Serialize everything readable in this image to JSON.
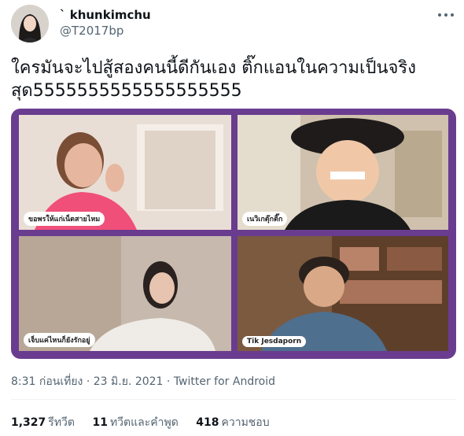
{
  "user": {
    "display_name": "` khunkimchu",
    "handle": "@T2017bp"
  },
  "tweet": {
    "line1": "ใครมันจะไปสู้สองคนนี้ดีกันเอง ติ๊กแอนในความเป็นจริง",
    "line2": "สุด5555555555555555555"
  },
  "video_call": {
    "participants": [
      {
        "name": "ขอพรให้แก่เน็ตสายไหม"
      },
      {
        "name": "เนวิเกตุ๊กติ๊ก"
      },
      {
        "name": "เจ็บแค่ไหนก็ยังรักอยู่"
      },
      {
        "name": "Tik Jesdaporn"
      }
    ]
  },
  "meta": {
    "time": "8:31 ก่อนเที่ยง",
    "sep1": " · ",
    "date": "23 มิ.ย. 2021",
    "sep2": " · ",
    "source": "Twitter for Android"
  },
  "stats": {
    "retweets": {
      "count": "1,327",
      "label": "รีทวีต"
    },
    "quotes": {
      "count": "11",
      "label": "ทวีตและคำพูด"
    },
    "likes": {
      "count": "418",
      "label": "ความชอบ"
    }
  },
  "colors": {
    "frame": "#6a3c8f",
    "text": "#0f1419",
    "muted": "#536471"
  },
  "icons": [
    "more-options-icon"
  ]
}
